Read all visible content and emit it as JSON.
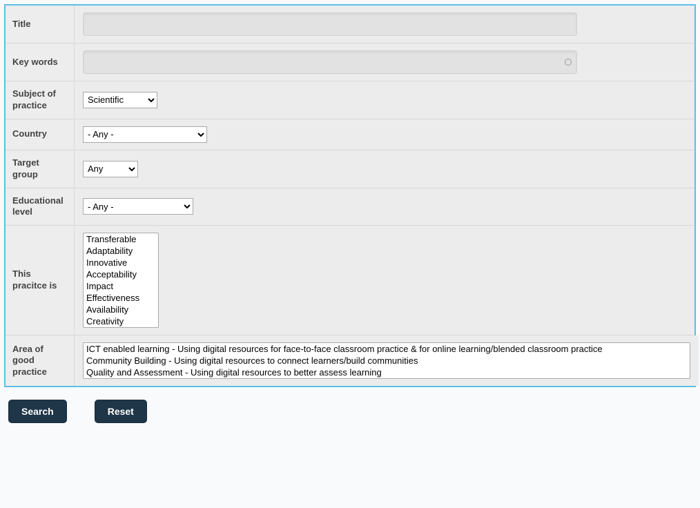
{
  "labels": {
    "title": "Title",
    "keywords": "Key words",
    "subject": "Subject of practice",
    "country": "Country",
    "target_group": "Target group",
    "edu_level": "Educational level",
    "practice_is": "This pracitce is",
    "area": "Area of good practice"
  },
  "fields": {
    "title_value": "",
    "keywords_value": "",
    "subject_selected": "Scientific",
    "subject_options": [
      "Scientific"
    ],
    "country_selected": "- Any -",
    "country_options": [
      "- Any -"
    ],
    "target_group_selected": "Any",
    "target_group_options": [
      "Any"
    ],
    "edu_level_selected": "- Any -",
    "edu_level_options": [
      "- Any -"
    ],
    "practice_options": [
      "Transferable",
      "Adaptability",
      "Innovative",
      "Acceptability",
      "Impact",
      "Effectiveness",
      "Availability",
      "Creativity"
    ],
    "area_options": [
      "ICT enabled learning - Using digital resources for face-to-face classroom practice & for online learning/blended classroom practice",
      "Community Building - Using digital resources to connect learners/build communities",
      "Quality and Assessment - Using digital resources to better assess learning"
    ]
  },
  "buttons": {
    "search": "Search",
    "reset": "Reset"
  }
}
